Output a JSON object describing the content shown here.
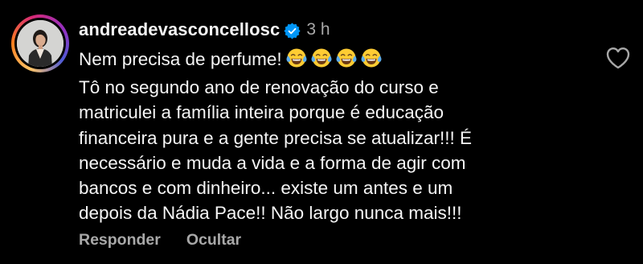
{
  "comment": {
    "username": "andreadevasconcellosc",
    "timestamp": "3 h",
    "first_line": "Nem precisa de perfume!",
    "emoji_icons": [
      "tears-of-joy-emoji",
      "tears-of-joy-emoji",
      "tears-of-joy-emoji",
      "tears-of-joy-emoji"
    ],
    "body_lines": [
      "Tô no segundo ano de renovação do curso e",
      "matriculei a família inteira porque é educação",
      "financeira pura e a gente precisa se atualizar!!! É",
      "necessário e muda a vida e a forma de agir com",
      "bancos e com dinheiro... existe um antes e um",
      "depois da Nádia Pace!! Não largo nunca mais!!!"
    ],
    "actions": {
      "reply": "Responder",
      "hide": "Ocultar"
    }
  },
  "colors": {
    "background": "#000000",
    "text_primary": "#f5f5f5",
    "text_secondary": "#a8a8a8",
    "verified_badge": "#0095f6"
  },
  "icons": [
    "avatar",
    "verified-badge-icon",
    "heart-outline-icon"
  ]
}
